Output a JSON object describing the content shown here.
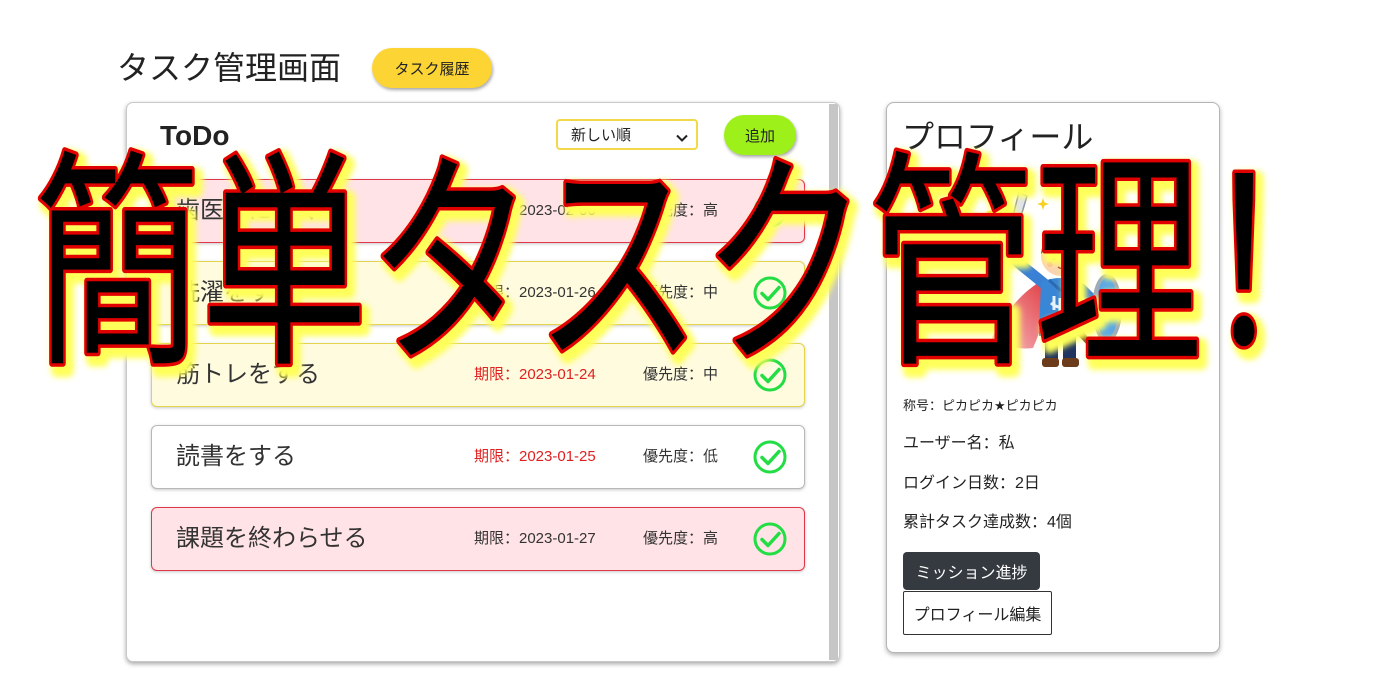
{
  "page": {
    "title": "タスク管理画面",
    "history_button": "タスク履歴"
  },
  "todo": {
    "title": "ToDo",
    "sort_select": {
      "selected": "新しい順",
      "icon": "chevron-down-icon"
    },
    "add_button": "追加",
    "tasks": [
      {
        "title": "歯医者に行く",
        "deadline": "期限：2023-02-06",
        "priority": "優先度：高",
        "done_icon": "check-circle-icon",
        "card_color": "#ffe3e6",
        "border_color": "#e0364a",
        "deadline_color": "#333333"
      },
      {
        "title": "洗濯をする",
        "deadline": "期限：2023-01-26",
        "priority": "優先度：中",
        "done_icon": "check-circle-icon",
        "card_color": "#fffbdf",
        "border_color": "#e2d44c",
        "deadline_color": "#333333"
      },
      {
        "title": "筋トレをする",
        "deadline": "期限：2023-01-24",
        "priority": "優先度：中",
        "done_icon": "check-circle-icon",
        "card_color": "#fffbdf",
        "border_color": "#e2d44c",
        "deadline_color": "#e02020"
      },
      {
        "title": "読書をする",
        "deadline": "期限：2023-01-25",
        "priority": "優先度：低",
        "done_icon": "check-circle-icon",
        "card_color": "#ffffff",
        "border_color": "#b8b8b8",
        "deadline_color": "#e02020"
      },
      {
        "title": "課題を終わらせる",
        "deadline": "期限：2023-01-27",
        "priority": "優先度：高",
        "done_icon": "check-circle-icon",
        "card_color": "#ffe3e6",
        "border_color": "#e0364a",
        "deadline_color": "#333333"
      }
    ]
  },
  "profile": {
    "title": "プロフィール",
    "avatar_icon": "hero-icon",
    "rank": "称号：ピカピカ★ピカピカ",
    "username": "ユーザー名：私",
    "login_days": "ログイン日数：2日",
    "total_completed": "累計タスク達成数：4個",
    "mission_button": "ミッション進捗",
    "edit_button": "プロフィール編集"
  },
  "overlay": {
    "title": "簡単タスク管理！"
  },
  "colors": {
    "history_button": "#fcd535",
    "add_button": "#9ef01a",
    "check_icon": "#22dd44",
    "mission_button": "#343a40",
    "overlay_fill": "#000000",
    "overlay_outline": "#e00000",
    "overlay_glow": "#ffff5a"
  }
}
